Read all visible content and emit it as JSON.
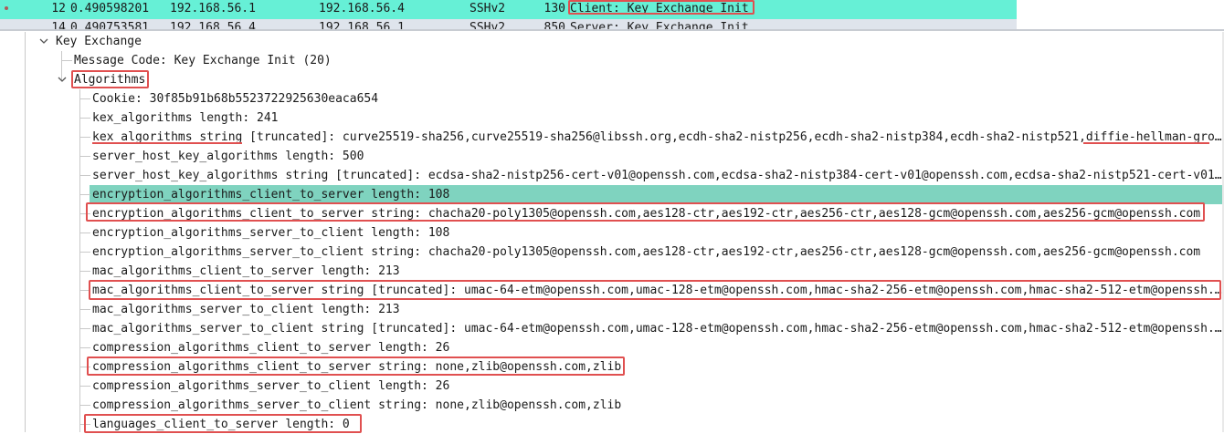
{
  "packet_list": {
    "selected": {
      "no": "12",
      "time": "0.490598201",
      "src": "192.168.56.1",
      "dst": "192.168.56.4",
      "proto": "SSHv2",
      "len": "130",
      "info": "Client: Key Exchange Init"
    },
    "next": {
      "no": "14",
      "time": "0.490753581",
      "src": "192.168.56.4",
      "dst": "192.168.56.1",
      "proto": "SSHv2",
      "len": "850",
      "info": "Server: Key Exchange Init"
    }
  },
  "tree": {
    "key_exchange": "Key Exchange",
    "message_code": "Message Code: Key Exchange Init (20)",
    "algorithms": "Algorithms",
    "fields": [
      "Cookie: 30f85b91b68b5523722925630eaca654",
      "kex_algorithms length: 241",
      "kex_algorithms string [truncated]: curve25519-sha256,curve25519-sha256@libssh.org,ecdh-sha2-nistp256,ecdh-sha2-nistp384,ecdh-sha2-nistp521,diffie-hellman-gro…",
      "server_host_key_algorithms length: 500",
      "server_host_key_algorithms string [truncated]: ecdsa-sha2-nistp256-cert-v01@openssh.com,ecdsa-sha2-nistp384-cert-v01@openssh.com,ecdsa-sha2-nistp521-cert-v01…",
      "encryption_algorithms_client_to_server length: 108",
      "encryption_algorithms_client_to_server string: chacha20-poly1305@openssh.com,aes128-ctr,aes192-ctr,aes256-ctr,aes128-gcm@openssh.com,aes256-gcm@openssh.com",
      "encryption_algorithms_server_to_client length: 108",
      "encryption_algorithms_server_to_client string: chacha20-poly1305@openssh.com,aes128-ctr,aes192-ctr,aes256-ctr,aes128-gcm@openssh.com,aes256-gcm@openssh.com",
      "mac_algorithms_client_to_server length: 213",
      "mac_algorithms_client_to_server string [truncated]: umac-64-etm@openssh.com,umac-128-etm@openssh.com,hmac-sha2-256-etm@openssh.com,hmac-sha2-512-etm@openssh.…",
      "mac_algorithms_server_to_client length: 213",
      "mac_algorithms_server_to_client string [truncated]: umac-64-etm@openssh.com,umac-128-etm@openssh.com,hmac-sha2-256-etm@openssh.com,hmac-sha2-512-etm@openssh.…",
      "compression_algorithms_client_to_server length: 26",
      "compression_algorithms_client_to_server string: none,zlib@openssh.com,zlib",
      "compression_algorithms_server_to_client length: 26",
      "compression_algorithms_server_to_client string: none,zlib@openssh.com,zlib",
      "languages_client_to_server length: 0"
    ]
  },
  "colors": {
    "selected_packet": "#66f0d6",
    "selected_field": "#7fd3bf",
    "highlight_annotation": "#e05050"
  },
  "icons": {
    "expand": "chevron-down-icon"
  }
}
